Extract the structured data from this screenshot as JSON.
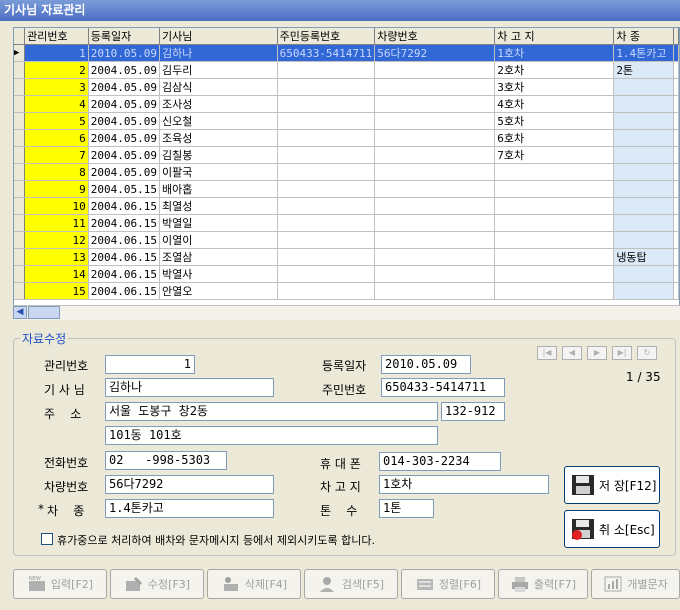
{
  "window": {
    "title": "기사님 자료관리"
  },
  "grid": {
    "headers": [
      "관리번호",
      "등록일자",
      "기사님",
      "주민등록번호",
      "차량번호",
      "차 고 지",
      "차  종"
    ],
    "rows": [
      [
        "1",
        "2010.05.09",
        "김하나",
        "650433-5414711",
        "56다7292",
        "1호차",
        "1.4톤카고"
      ],
      [
        "2",
        "2004.05.09",
        "김두리",
        "",
        "",
        "2호차",
        "2톤"
      ],
      [
        "3",
        "2004.05.09",
        "김삼식",
        "",
        "",
        "3호차",
        ""
      ],
      [
        "4",
        "2004.05.09",
        "조사성",
        "",
        "",
        "4호차",
        ""
      ],
      [
        "5",
        "2004.05.09",
        "신오철",
        "",
        "",
        "5호차",
        ""
      ],
      [
        "6",
        "2004.05.09",
        "조육성",
        "",
        "",
        "6호차",
        ""
      ],
      [
        "7",
        "2004.05.09",
        "김칠봉",
        "",
        "",
        "7호차",
        ""
      ],
      [
        "8",
        "2004.05.09",
        "이팔국",
        "",
        "",
        "",
        ""
      ],
      [
        "9",
        "2004.05.15",
        "배아홉",
        "",
        "",
        "",
        ""
      ],
      [
        "10",
        "2004.06.15",
        "최열성",
        "",
        "",
        "",
        ""
      ],
      [
        "11",
        "2004.06.15",
        "박열일",
        "",
        "",
        "",
        ""
      ],
      [
        "12",
        "2004.06.15",
        "이열이",
        "",
        "",
        "",
        ""
      ],
      [
        "13",
        "2004.06.15",
        "조열삼",
        "",
        "",
        "",
        "냉동탑"
      ],
      [
        "14",
        "2004.06.15",
        "박열사",
        "",
        "",
        "",
        ""
      ],
      [
        "15",
        "2004.06.15",
        "안열오",
        "",
        "",
        "",
        ""
      ]
    ]
  },
  "form": {
    "legend": "자료수정",
    "labels": {
      "mgmt_no": "관리번호",
      "reg_date": "등록일자",
      "driver": "기 사 님",
      "rrn": "주민번호",
      "address": "주    소",
      "phone": "전화번호",
      "mobile": "휴 대 폰",
      "vehicle_no": "차량번호",
      "garage": "차 고 지",
      "vehicle_type": "차    종",
      "tonnage": "톤    수",
      "required_mark": "*"
    },
    "values": {
      "mgmt_no": "1",
      "reg_date": "2010.05.09",
      "driver": "김하나",
      "rrn": "650433-5414711",
      "address1": "서울 도봉구 창2동",
      "address_zip": "132-912",
      "address2": "101동 101호",
      "phone": "02   -998-5303",
      "mobile": "014-303-2234",
      "vehicle_no": "56다7292",
      "garage": "1호차",
      "vehicle_type": "1.4톤카고",
      "tonnage": "1톤"
    },
    "record_counter": "1 / 35",
    "leave_checkbox_label": "휴가중으로 처리하여 배차와 문자메시지 등에서 제외시키도록 합니다.",
    "save_button": "저 장[F12]",
    "cancel_button": "취 소[Esc]"
  },
  "toolbar": {
    "input": "입력[F2]",
    "edit": "수정[F3]",
    "delete": "삭제[F4]",
    "search": "검색[F5]",
    "sort": "정렬[F6]",
    "print": "출력[F7]",
    "sms": "개별문자"
  },
  "colors": {
    "title_bar": "#5b7ed1",
    "selected_row": "#3168d5",
    "mgmt_no_cell": "#ffff00",
    "type_cell": "#dce9f7",
    "legend_text": "#1e4fc7"
  }
}
